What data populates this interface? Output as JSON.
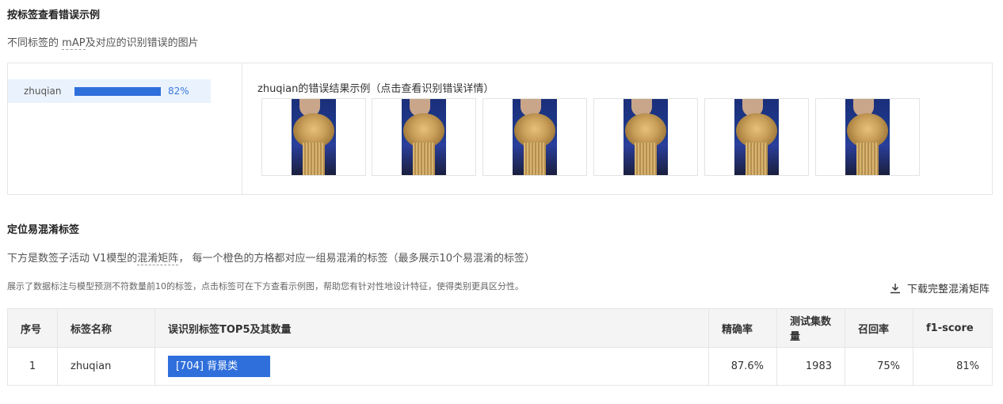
{
  "section1": {
    "title": "按标签查看错误示例",
    "desc_prefix": "不同标签的",
    "desc_link": "mAP",
    "desc_suffix": "及对应的识别错误的图片"
  },
  "tag_list": [
    {
      "name": "zhuqian",
      "map_percent": 82,
      "map_label": "82%"
    }
  ],
  "examples": {
    "title": "zhuqian的错误结果示例（点击查看识别错误详情）",
    "image_count": 6
  },
  "section2": {
    "title": "定位易混淆标签",
    "desc_prefix": "下方是数签子活动 V1模型的",
    "desc_link": "混淆矩阵",
    "desc_suffix": "， 每一个橙色的方格都对应一组易混淆的标签（最多展示10个易混淆的标签）",
    "note": "展示了数据标注与模型预测不符数量前10的标签，点击标签可在下方查看示例图，帮助您有针对性地设计特征，使得类别更具区分性。",
    "download_label": "下载完整混淆矩阵"
  },
  "table": {
    "headers": {
      "index": "序号",
      "label_name": "标签名称",
      "top5": "误识别标签TOP5及其数量",
      "precision": "精确率",
      "test_count": "测试集数量",
      "recall": "召回率",
      "f1": "f1-score"
    },
    "rows": [
      {
        "index": "1",
        "label_name": "zhuqian",
        "top5": [
          "[704] 背景类"
        ],
        "precision": "87.6%",
        "test_count": "1983",
        "recall": "75%",
        "f1": "81%"
      }
    ]
  },
  "colors": {
    "accent": "#2f6fdc",
    "selected_row_bg": "#eaf3fd",
    "table_header_bg": "#f4f4f4"
  }
}
